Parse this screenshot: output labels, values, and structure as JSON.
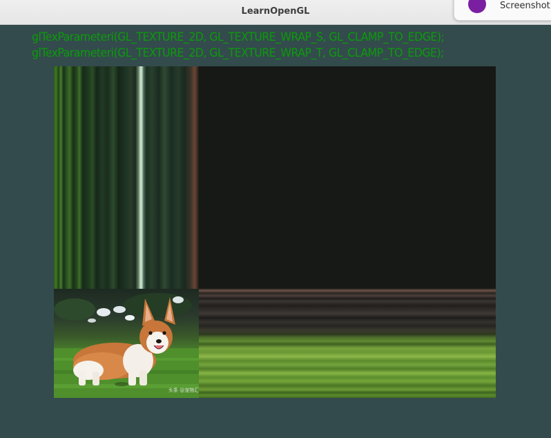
{
  "window": {
    "title": "LearnOpenGL"
  },
  "notification": {
    "text": "Screenshot"
  },
  "overlay": {
    "line1": "glTexParameteri(GL_TEXTURE_2D, GL_TEXTURE_WRAP_S, GL_CLAMP_TO_EDGE);",
    "line2": "glTexParameteri(GL_TEXTURE_2D, GL_TEXTURE_WRAP_T, GL_CLAMP_TO_EDGE);"
  },
  "texture": {
    "subject": "corgi-photo",
    "watermark": "头条 @宠物汇"
  },
  "colors": {
    "clear_color": "#334b4c",
    "overlay_text": "#0c9a0c",
    "titlebar": "#ebebeb"
  }
}
